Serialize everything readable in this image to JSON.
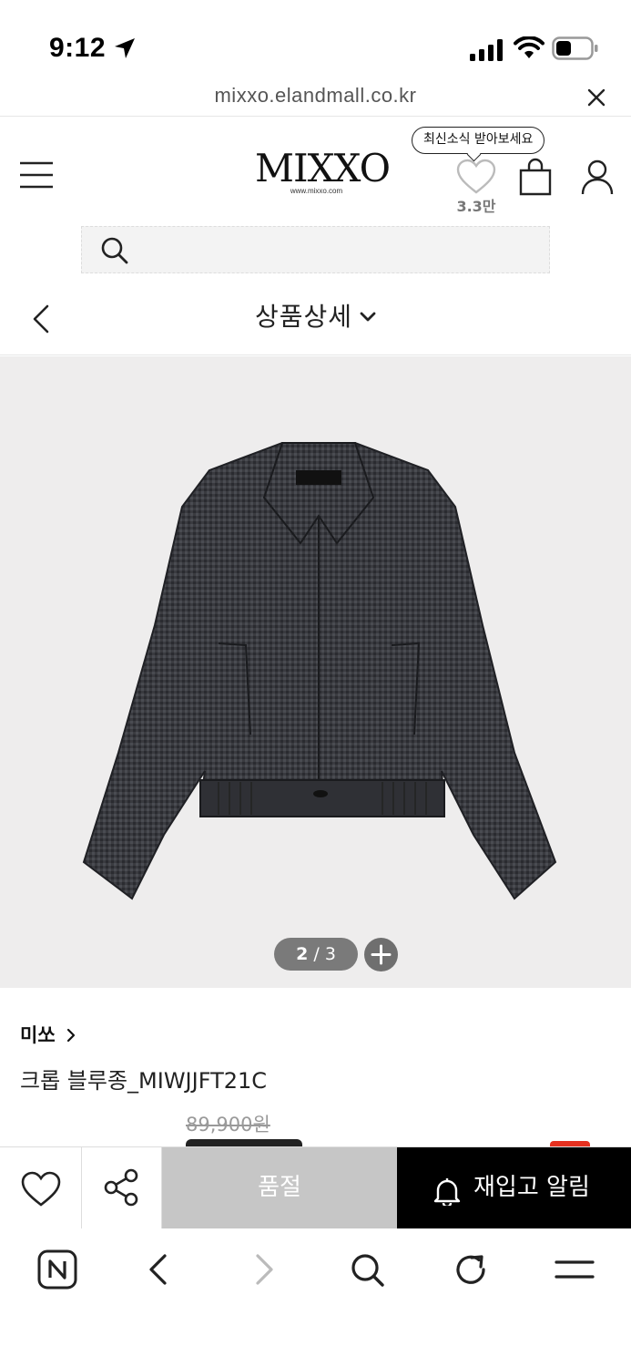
{
  "status_bar": {
    "time": "9:12"
  },
  "browser": {
    "url": "mixxo.elandmall.co.kr"
  },
  "header": {
    "logo_text": "MIXXO",
    "logo_url_text": "www.mixxo.com",
    "tooltip": "최신소식 받아보세요",
    "wish_count": "3.3만"
  },
  "search": {
    "placeholder": ""
  },
  "subheader": {
    "title": "상품상세"
  },
  "gallery": {
    "current": "2",
    "separator": " / ",
    "total": "3"
  },
  "product": {
    "brand": "미쏘",
    "name": "크롭 블루종_MIWJJFT21C",
    "original_price": "89,900원"
  },
  "action_bar": {
    "soldout_label": "품절",
    "restock_label": "재입고 알림"
  },
  "colors": {
    "accent_dark": "#000000",
    "soldout_gray": "#c6c6c6",
    "discount_red": "#e6301f"
  }
}
